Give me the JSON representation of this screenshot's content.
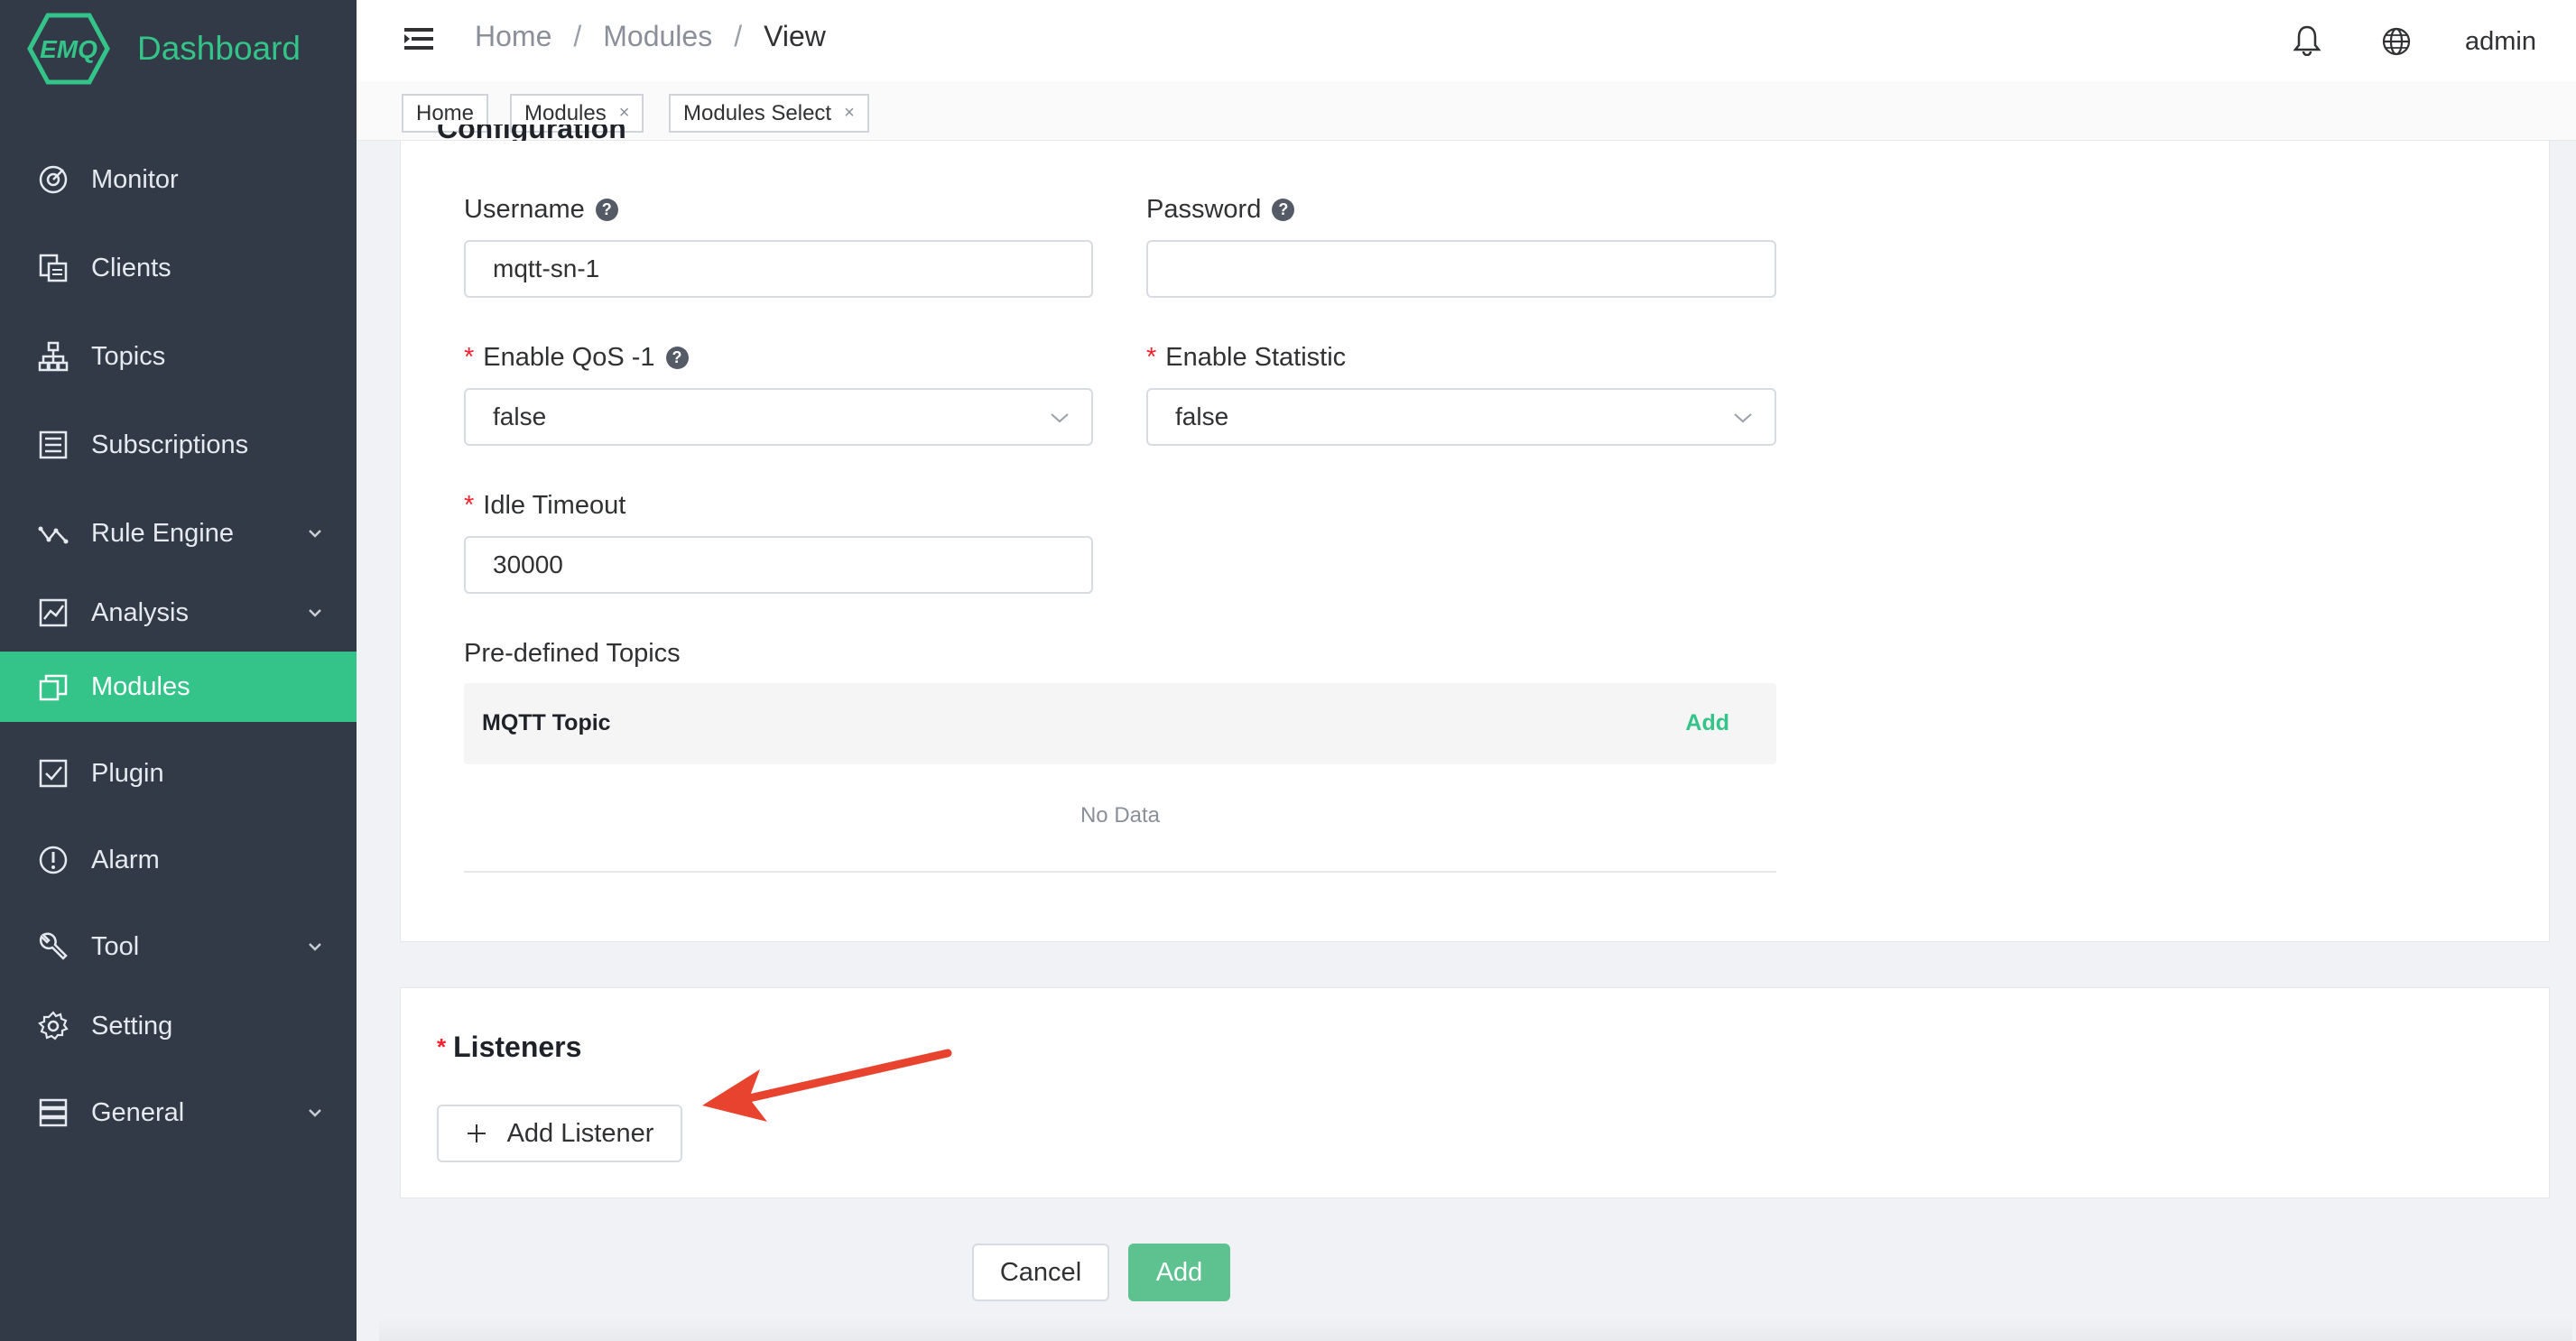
{
  "app": {
    "title": "Dashboard",
    "logo_text": "EMQ"
  },
  "sidebar": {
    "items": [
      {
        "label": "Monitor",
        "icon": "monitor-icon",
        "has_arrow": false
      },
      {
        "label": "Clients",
        "icon": "clients-icon",
        "has_arrow": false
      },
      {
        "label": "Topics",
        "icon": "topics-icon",
        "has_arrow": false
      },
      {
        "label": "Subscriptions",
        "icon": "subscriptions-icon",
        "has_arrow": false
      },
      {
        "label": "Rule Engine",
        "icon": "rule-engine-icon",
        "has_arrow": true
      },
      {
        "label": "Analysis",
        "icon": "analysis-icon",
        "has_arrow": true
      },
      {
        "label": "Modules",
        "icon": "modules-icon",
        "has_arrow": false,
        "active": true
      },
      {
        "label": "Plugin",
        "icon": "plugin-icon",
        "has_arrow": false
      },
      {
        "label": "Alarm",
        "icon": "alarm-icon",
        "has_arrow": false
      },
      {
        "label": "Tool",
        "icon": "tool-icon",
        "has_arrow": true
      },
      {
        "label": "Setting",
        "icon": "setting-icon",
        "has_arrow": false
      },
      {
        "label": "General",
        "icon": "general-icon",
        "has_arrow": true
      }
    ]
  },
  "header": {
    "breadcrumb": [
      "Home",
      "Modules",
      "View"
    ],
    "user": "admin"
  },
  "tags": [
    {
      "label": "Home",
      "closable": false
    },
    {
      "label": "Modules",
      "closable": true
    },
    {
      "label": "Modules Select",
      "closable": true
    }
  ],
  "config": {
    "title": "Configuration",
    "username": {
      "label": "Username",
      "value": "mqtt-sn-1"
    },
    "password": {
      "label": "Password",
      "value": ""
    },
    "enable_qos": {
      "label": "Enable QoS -1",
      "value": "false"
    },
    "enable_statistic": {
      "label": "Enable Statistic",
      "value": "false"
    },
    "idle_timeout": {
      "label": "Idle Timeout",
      "value": "30000"
    },
    "predefined_topics": {
      "label": "Pre-defined Topics",
      "column": "MQTT Topic",
      "add_label": "Add",
      "empty_text": "No Data"
    }
  },
  "listeners": {
    "title": "Listeners",
    "add_button": "Add Listener"
  },
  "footer": {
    "cancel": "Cancel",
    "submit": "Add"
  },
  "colors": {
    "accent": "#34c388",
    "sidebar_bg": "#323a47",
    "required": "#f5222d",
    "annotation_arrow": "#e8432e"
  }
}
